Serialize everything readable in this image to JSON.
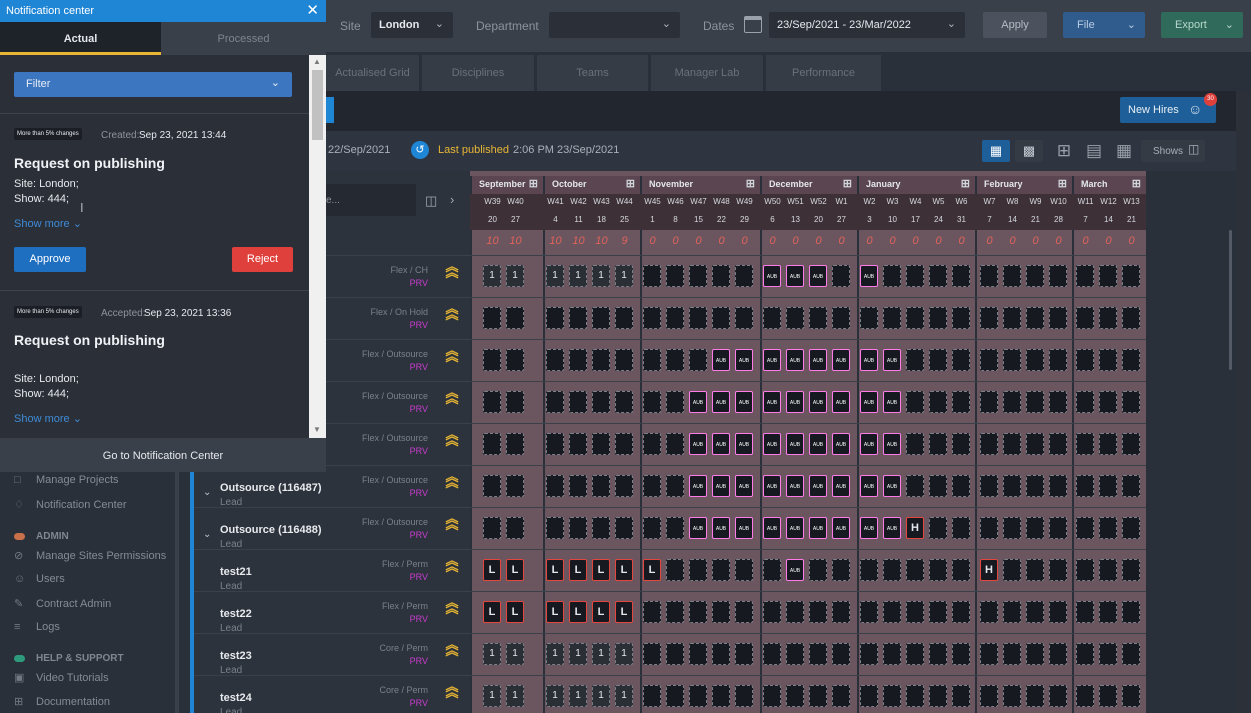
{
  "topbar": {
    "site_label": "Site",
    "site_value": "London",
    "department_label": "Department",
    "department_value": "",
    "dates_label": "Dates",
    "dates_value": "23/Sep/2021 - 23/Mar/2022",
    "apply": "Apply",
    "file": "File",
    "export": "Export"
  },
  "tabs": [
    "Actualised Grid",
    "Disciplines",
    "Teams",
    "Manager Lab",
    "Performance"
  ],
  "new_hires": {
    "label": "New Hires",
    "count": "30"
  },
  "publish": {
    "from": "22/Sep/2021",
    "label": "Last published",
    "time": "2:06 PM 23/Sep/2021"
  },
  "shows_label": "Shows",
  "search_placeholder": "e...",
  "months": [
    "September",
    "October",
    "November",
    "December",
    "January",
    "February",
    "March"
  ],
  "weeks": [
    {
      "w": "W39",
      "d": "20",
      "p": "10"
    },
    {
      "w": "W40",
      "d": "27",
      "p": "10"
    },
    {
      "w": "W41",
      "d": "4",
      "p": "10"
    },
    {
      "w": "W42",
      "d": "11",
      "p": "10"
    },
    {
      "w": "W43",
      "d": "18",
      "p": "10"
    },
    {
      "w": "W44",
      "d": "25",
      "p": "9"
    },
    {
      "w": "W45",
      "d": "1",
      "p": "0"
    },
    {
      "w": "W46",
      "d": "8",
      "p": "0"
    },
    {
      "w": "W47",
      "d": "15",
      "p": "0"
    },
    {
      "w": "W48",
      "d": "22",
      "p": "0"
    },
    {
      "w": "W49",
      "d": "29",
      "p": "0"
    },
    {
      "w": "W50",
      "d": "6",
      "p": "0"
    },
    {
      "w": "W51",
      "d": "13",
      "p": "0"
    },
    {
      "w": "W52",
      "d": "20",
      "p": "0"
    },
    {
      "w": "W1",
      "d": "27",
      "p": "0"
    },
    {
      "w": "W2",
      "d": "3",
      "p": "0"
    },
    {
      "w": "W3",
      "d": "10",
      "p": "0"
    },
    {
      "w": "W4",
      "d": "17",
      "p": "0"
    },
    {
      "w": "W5",
      "d": "24",
      "p": "0"
    },
    {
      "w": "W6",
      "d": "31",
      "p": "0"
    },
    {
      "w": "W7",
      "d": "7",
      "p": "0"
    },
    {
      "w": "W8",
      "d": "14",
      "p": "0"
    },
    {
      "w": "W9",
      "d": "21",
      "p": "0"
    },
    {
      "w": "W10",
      "d": "28",
      "p": "0"
    },
    {
      "w": "W11",
      "d": "7",
      "p": "0"
    },
    {
      "w": "W12",
      "d": "14",
      "p": "0"
    },
    {
      "w": "W13",
      "d": "21",
      "p": "0"
    }
  ],
  "rows": [
    {
      "name": "",
      "sub": "",
      "type": "Flex / CH",
      "prv": "PRV",
      "cells": "11111100000FFN0F0000000000"
    },
    {
      "name": "",
      "sub": "",
      "type": "Flex / On Hold",
      "prv": "PRV",
      "cells": "000000000000000000000000000"
    },
    {
      "name": "",
      "sub": "",
      "type": "Flex / Outsource",
      "prv": "PRV",
      "cells": "000000000FFFFFFFF0000000000"
    },
    {
      "name": "",
      "sub": "",
      "type": "Flex / Outsource",
      "prv": "PRV",
      "cells": "00000000FFFFFFFFF0000000000"
    },
    {
      "name": "",
      "sub": "",
      "type": "Flex / Outsource",
      "prv": "PRV",
      "cells": "00000000FFFFFFFFF0000000000"
    },
    {
      "name": "Outsource (116487)",
      "sub": "Lead",
      "type": "Flex / Outsource",
      "prv": "PRV",
      "cells": "00000000FFFFFFFFF0000000000"
    },
    {
      "name": "Outsource (116488)",
      "sub": "Lead",
      "type": "Flex / Outsource",
      "prv": "PRV",
      "cells": "00000000FFFFFFFFFH000000000"
    },
    {
      "name": "test21",
      "sub": "Lead",
      "type": "Flex / Perm",
      "prv": "PRV",
      "cells": "LLLLLLL00000F0000000H000000"
    },
    {
      "name": "test22",
      "sub": "Lead",
      "type": "Flex / Perm",
      "prv": "PRV",
      "cells": "LLLLLL000000000000000000000"
    },
    {
      "name": "test23",
      "sub": "Lead",
      "type": "Core / Perm",
      "prv": "PRV",
      "cells": "111111000000000000000000000"
    },
    {
      "name": "test24",
      "sub": "Lead",
      "type": "Core / Perm",
      "prv": "PRV",
      "cells": "111111000000000000000000000"
    }
  ],
  "aub_label": "AUB",
  "sidebar": {
    "items": [
      {
        "label": "Manage Projects",
        "icon": "folder-icon"
      },
      {
        "label": "Notification Center",
        "icon": "bell-icon"
      }
    ],
    "admin_title": "ADMIN",
    "admin_items": [
      {
        "label": "Manage Sites Permissions",
        "icon": "shield-icon"
      },
      {
        "label": "Users",
        "icon": "users-icon"
      },
      {
        "label": "Contract Admin",
        "icon": "contract-icon"
      },
      {
        "label": "Logs",
        "icon": "logs-icon"
      }
    ],
    "help_title": "HELP & SUPPORT",
    "help_items": [
      {
        "label": "Video Tutorials",
        "icon": "video-icon"
      },
      {
        "label": "Documentation",
        "icon": "doc-icon"
      }
    ]
  },
  "panel": {
    "title": "Notification center",
    "tab_actual": "Actual",
    "tab_processed": "Processed",
    "filter": "Filter",
    "notifications": [
      {
        "badge": "More than 5% changes",
        "meta_label": "Created:",
        "meta_time": "Sep 23, 2021 13:44",
        "title": "Request on publishing",
        "site": "Site: London;",
        "show": "Show: 444;",
        "show_more": "Show more",
        "approve": "Approve",
        "reject": "Reject"
      },
      {
        "badge": "More than 5% changes",
        "meta_label": "Accepted:",
        "meta_time": "Sep 23, 2021 13:36",
        "title": "Request on publishing",
        "site": "Site: London;",
        "show": "Show: 444;",
        "show_more": "Show more"
      }
    ],
    "footer": "Go to Notification Center"
  },
  "colors": {
    "accent": "#1f86d6",
    "reject": "#e0403c",
    "aub": "#ef35d4",
    "grid": "#6b5660"
  }
}
